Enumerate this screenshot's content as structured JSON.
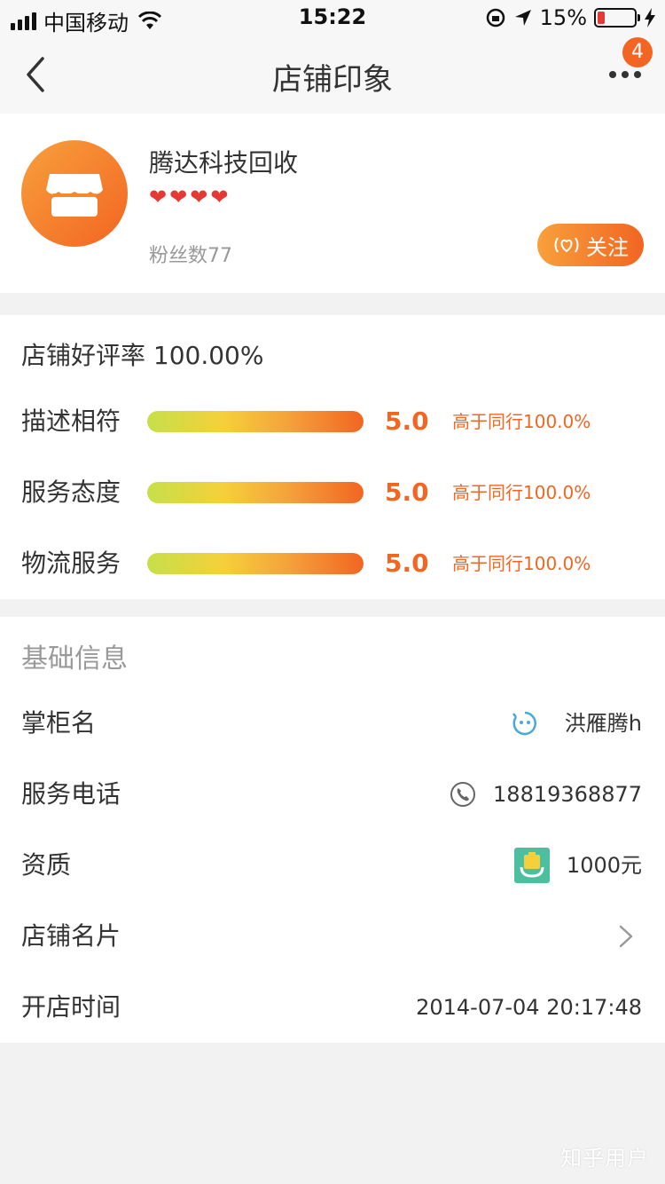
{
  "status_bar": {
    "carrier": "中国移动",
    "time": "15:22",
    "battery": "15%"
  },
  "nav": {
    "title": "店铺印象",
    "badge": "4"
  },
  "shop": {
    "name": "腾达科技回收",
    "hearts": 4,
    "fans": "粉丝数77",
    "follow": "关注"
  },
  "rating": {
    "title": "店铺好评率 100.00%",
    "rows": [
      {
        "label": "描述相符",
        "score": "5.0",
        "compare": "高于同行100.0%",
        "level": 1.0
      },
      {
        "label": "服务态度",
        "score": "5.0",
        "compare": "高于同行100.0%",
        "level": 1.0
      },
      {
        "label": "物流服务",
        "score": "5.0",
        "compare": "高于同行100.0%",
        "level": 1.0
      }
    ]
  },
  "info": {
    "title": "基础信息",
    "rows": [
      {
        "label": "掌柜名",
        "value": "洪雁腾h",
        "icon": "smiley-icon"
      },
      {
        "label": "服务电话",
        "value": "18819368877",
        "icon": "phone-icon"
      },
      {
        "label": "资质",
        "value": "1000元",
        "icon": "deposit-icon"
      },
      {
        "label": "店铺名片",
        "value": "",
        "icon": "chevron-right-icon"
      },
      {
        "label": "开店时间",
        "value": "2014-07-04 20:17:48",
        "icon": ""
      }
    ]
  },
  "watermark": "知乎用户",
  "colors": {
    "accent": "#f26522",
    "accent_light": "#f8a03c",
    "background": "#f2f2f2"
  }
}
